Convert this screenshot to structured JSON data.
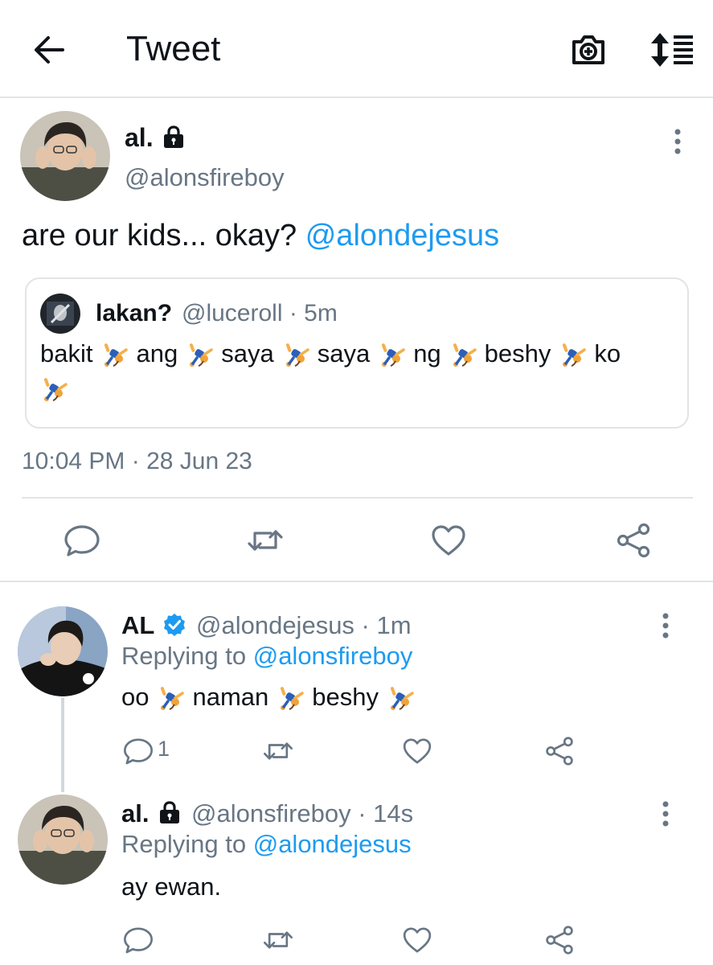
{
  "header": {
    "title": "Tweet"
  },
  "tweet": {
    "author_name": "al.",
    "author_handle": "@alonsfireboy",
    "text_prefix": "are our kids... okay? ",
    "text_mention": "@alondejesus",
    "quote": {
      "name": "lakan?",
      "meta": "@luceroll · 5m",
      "words": [
        "bakit",
        "ang",
        "saya",
        "saya",
        "ng",
        "beshy",
        "ko"
      ]
    },
    "timestamp": "10:04 PM · 28 Jun 23"
  },
  "replies": [
    {
      "name": "AL",
      "meta": "@alondejesus · 1m",
      "replying_label": "Replying to ",
      "replying_to": "@alonsfireboy",
      "words": [
        "oo",
        "naman",
        "beshy"
      ],
      "reply_count": "1"
    },
    {
      "name": "al.",
      "meta": "@alonsfireboy · 14s",
      "replying_label": "Replying to ",
      "replying_to": "@alondejesus",
      "text": "ay ewan."
    }
  ],
  "icons": {
    "back": "arrow-left-icon",
    "camera": "camera-plus-icon",
    "sort": "sort-icon",
    "lock": "lock-icon",
    "verified": "verified-badge-icon",
    "more": "more-vertical-icon",
    "reply": "reply-icon",
    "retweet": "retweet-icon",
    "like": "heart-icon",
    "share": "share-icon",
    "emoji": "person-cartwheeling-emoji"
  },
  "colors": {
    "link": "#1d9bf0",
    "secondary": "#687684",
    "divider": "#e1e4e6",
    "verified": "#1d9bf0"
  }
}
